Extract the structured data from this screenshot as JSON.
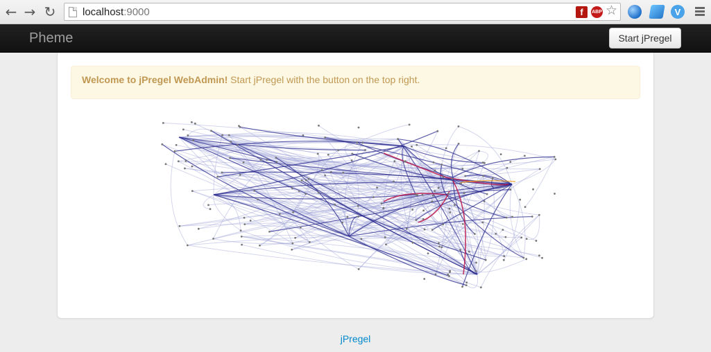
{
  "browser": {
    "url_host": "localhost",
    "url_port": ":9000",
    "icons": [
      "back-icon",
      "forward-icon",
      "reload-icon",
      "page-icon",
      "flash-icon",
      "adblock-icon",
      "star-icon",
      "globe-icon",
      "edit-icon",
      "v-icon",
      "menu-icon"
    ],
    "abp_label": "ABP",
    "flash_label": "f",
    "v_label": "V"
  },
  "navbar": {
    "brand": "Pheme",
    "start_button": "Start jPregel"
  },
  "alert": {
    "strong": "Welcome to jPregel WebAdmin!",
    "text": " Start jPregel with the button on the top right."
  },
  "footer": {
    "link": "jPregel"
  },
  "colors": {
    "edge_light": "#9fa3d6",
    "edge_dark": "#2a2a8c",
    "edge_red": "#c0184a",
    "edge_orange": "#f5a020",
    "node": "#777777"
  }
}
